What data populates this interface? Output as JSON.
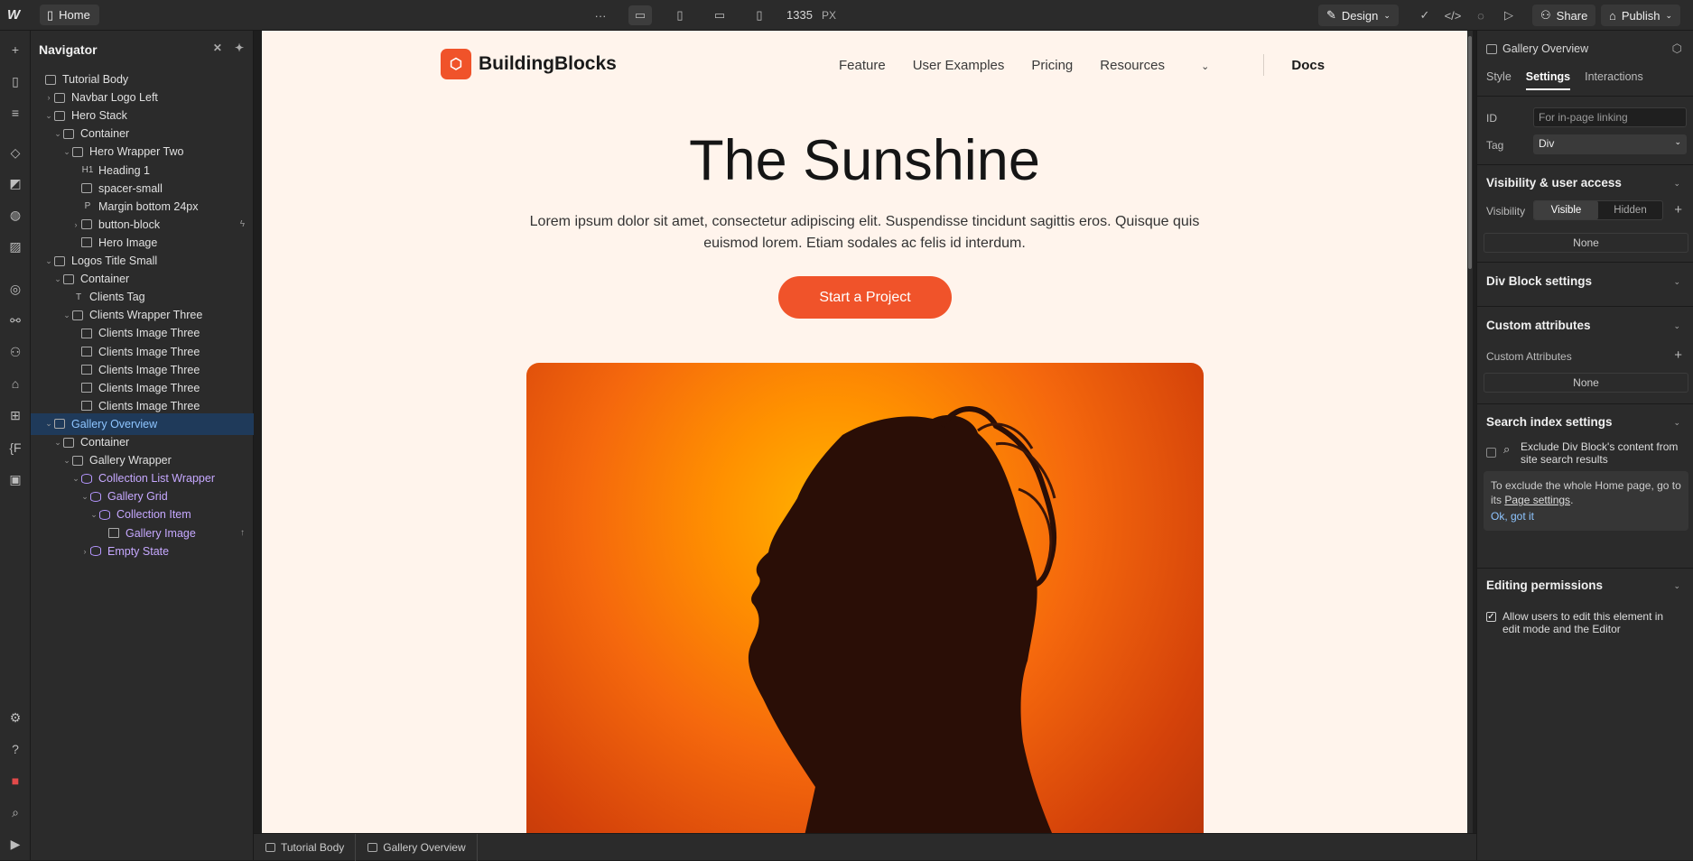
{
  "topbar": {
    "page_name": "Home",
    "more": "···",
    "canvas_width": "1335",
    "unit": "PX",
    "design_label": "Design",
    "share_label": "Share",
    "publish_label": "Publish"
  },
  "navigator": {
    "title": "Navigator",
    "items": [
      {
        "label": "Tutorial Body"
      },
      {
        "label": "Navbar Logo Left"
      },
      {
        "label": "Hero Stack"
      },
      {
        "label": "Container"
      },
      {
        "label": "Hero Wrapper Two"
      },
      {
        "label": "Heading 1",
        "tag": "H1"
      },
      {
        "label": "spacer-small"
      },
      {
        "label": "Margin bottom 24px",
        "tag": "P"
      },
      {
        "label": "button-block"
      },
      {
        "label": "Hero Image"
      },
      {
        "label": "Logos Title Small"
      },
      {
        "label": "Container"
      },
      {
        "label": "Clients Tag",
        "tag": "T"
      },
      {
        "label": "Clients Wrapper Three"
      },
      {
        "label": "Clients Image Three"
      },
      {
        "label": "Clients Image Three"
      },
      {
        "label": "Clients Image Three"
      },
      {
        "label": "Clients Image Three"
      },
      {
        "label": "Clients Image Three"
      },
      {
        "label": "Gallery Overview"
      },
      {
        "label": "Container"
      },
      {
        "label": "Gallery Wrapper"
      },
      {
        "label": "Collection List Wrapper"
      },
      {
        "label": "Gallery Grid"
      },
      {
        "label": "Collection Item"
      },
      {
        "label": "Gallery Image"
      },
      {
        "label": "Empty State"
      }
    ]
  },
  "site": {
    "logo_text": "BuildingBlocks",
    "nav": [
      "Feature",
      "User Examples",
      "Pricing",
      "Resources"
    ],
    "nav_docs": "Docs",
    "hero_title": "The Sunshine",
    "hero_sub": "Lorem ipsum dolor sit amet, consectetur adipiscing elit. Suspendisse tincidunt sagittis eros. Quisque quis euismod lorem. Etiam sodales ac felis id interdum.",
    "hero_button": "Start a Project"
  },
  "inspector": {
    "element_name": "Gallery Overview",
    "tabs": [
      "Style",
      "Settings",
      "Interactions"
    ],
    "id_label": "ID",
    "id_placeholder": "For in-page linking",
    "tag_label": "Tag",
    "tag_value": "Div",
    "visibility_section": "Visibility & user access",
    "visibility_label": "Visibility",
    "visible": "Visible",
    "hidden": "Hidden",
    "none1": "None",
    "div_block_section": "Div Block settings",
    "custom_attr_section": "Custom attributes",
    "custom_attr_label": "Custom Attributes",
    "none2": "None",
    "search_section": "Search index settings",
    "exclude_text": "Exclude Div Block's content from site search results",
    "info_text": "To exclude the whole Home page, go to its",
    "info_link": "Page settings",
    "info_ok": "Ok, got it",
    "editing_section": "Editing permissions",
    "allow_text": "Allow users to edit this element in edit mode and the Editor"
  },
  "breadcrumb": [
    "Tutorial Body",
    "Gallery Overview"
  ]
}
